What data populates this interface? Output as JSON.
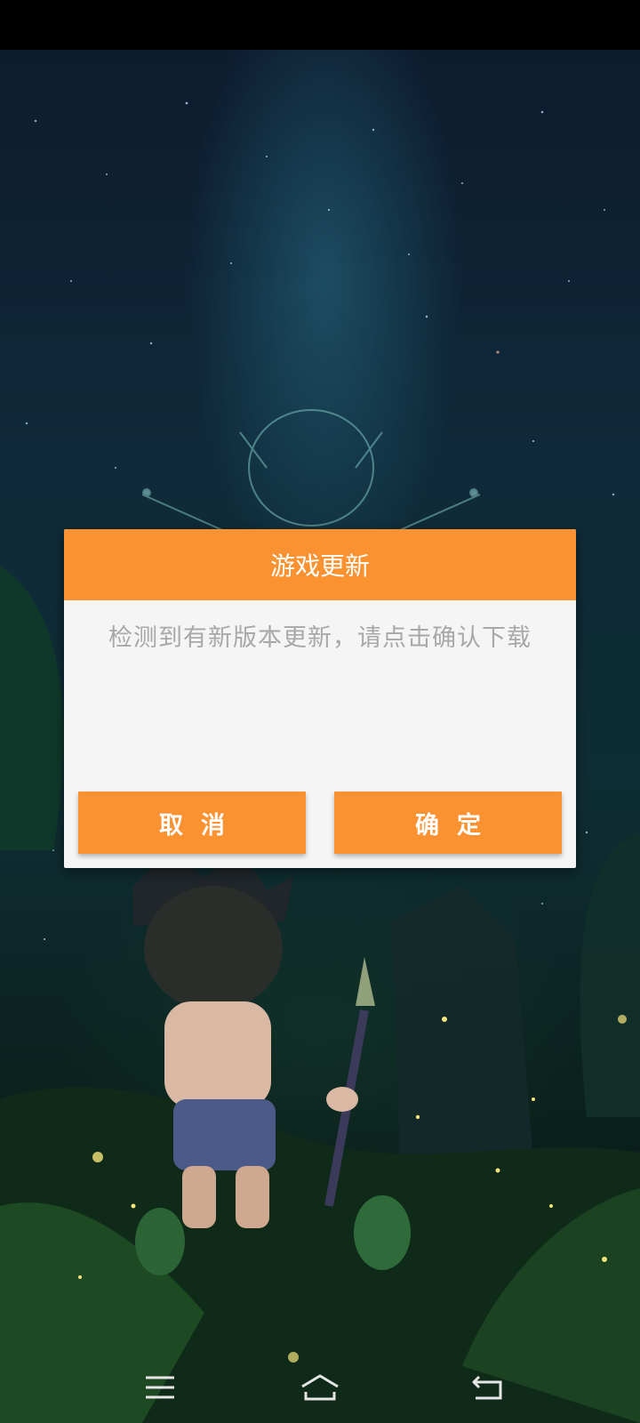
{
  "dialog": {
    "title": "游戏更新",
    "message": "检测到有新版本更新，请点击确认下载",
    "cancel_label": "取消",
    "confirm_label": "确定"
  },
  "colors": {
    "accent": "#fa9232",
    "dialog_bg": "#f5f5f5",
    "message_text": "#a8a8a8"
  },
  "nav": {
    "icons": [
      "menu-icon",
      "home-icon",
      "back-icon"
    ]
  }
}
